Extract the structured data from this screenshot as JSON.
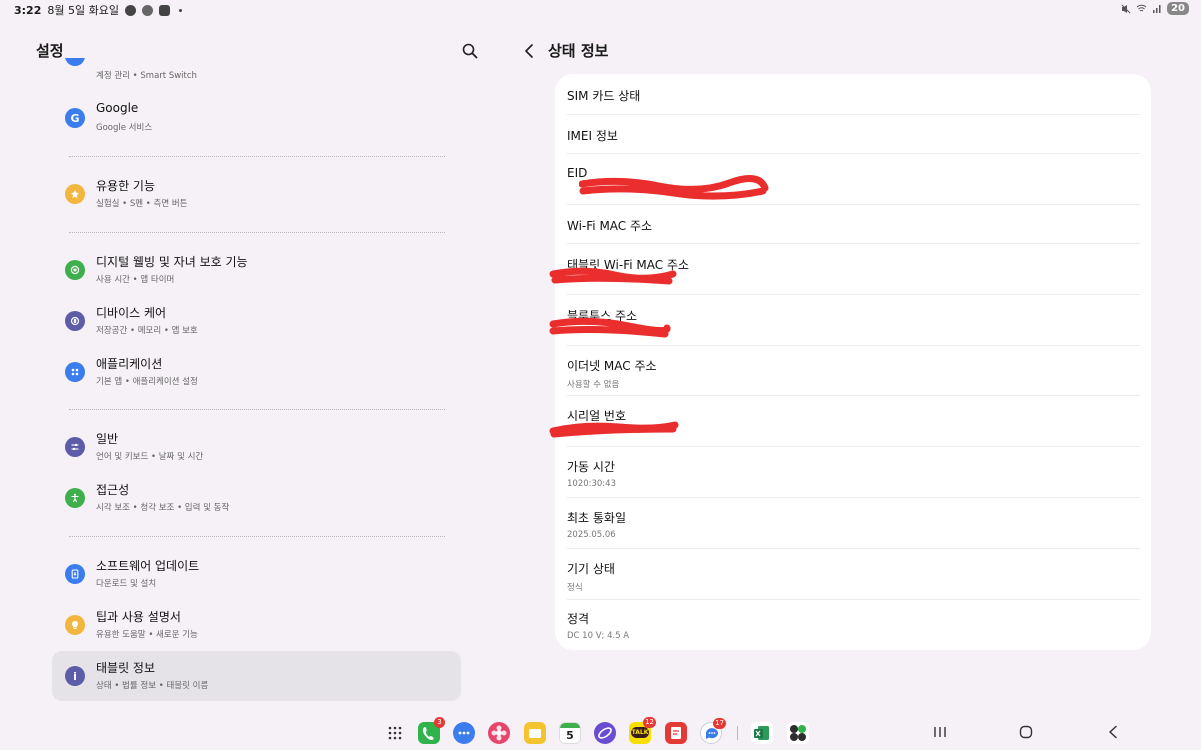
{
  "status_bar": {
    "time": "3:22",
    "date": "8월 5일 화요일",
    "battery": "20"
  },
  "left_panel": {
    "title": "설정",
    "partial_item_subtitle": "계정 관리 • Smart Switch",
    "items": [
      {
        "title": "Google",
        "subtitle": "Google 서비스",
        "icon": "google-icon",
        "color": "#3b7ded"
      },
      {
        "title": "유용한 기능",
        "subtitle": "실험실 • S펜 • 측면 버튼",
        "icon": "star-gear-icon",
        "color": "#f2b63f"
      },
      {
        "title": "디지털 웰빙 및 자녀 보호 기능",
        "subtitle": "사용 시간 • 앱 타이머",
        "icon": "wellbeing-heart-icon",
        "color": "#3fae4d"
      },
      {
        "title": "디바이스 케어",
        "subtitle": "저장공간 • 메모리 • 앱 보호",
        "icon": "device-care-icon",
        "color": "#5c5ca8"
      },
      {
        "title": "애플리케이션",
        "subtitle": "기본 앱 • 애플리케이션 설정",
        "icon": "apps-grid-icon",
        "color": "#3b7ded"
      },
      {
        "title": "일반",
        "subtitle": "언어 및 키보드 • 날짜 및 시간",
        "icon": "sliders-icon",
        "color": "#5c5ca8"
      },
      {
        "title": "접근성",
        "subtitle": "시각 보조 • 청각 보조 • 입력 및 동작",
        "icon": "accessibility-person-icon",
        "color": "#3fae4d"
      },
      {
        "title": "소프트웨어 업데이트",
        "subtitle": "다운로드 및 설치",
        "icon": "software-update-icon",
        "color": "#3b7ded"
      },
      {
        "title": "팁과 사용 설명서",
        "subtitle": "유용한 도움말 • 새로운 기능",
        "icon": "lightbulb-icon",
        "color": "#f2b63f"
      },
      {
        "title": "태블릿 정보",
        "subtitle": "상태 • 법률 정보 • 태블릿 이름",
        "icon": "info-icon",
        "color": "#5c5ca8"
      }
    ]
  },
  "right_panel": {
    "title": "상태 정보",
    "rows": [
      {
        "title": "SIM 카드 상태",
        "subtitle": ""
      },
      {
        "title": "IMEI 정보",
        "subtitle": ""
      },
      {
        "title": "EID",
        "subtitle": ""
      },
      {
        "title": "Wi-Fi MAC 주소",
        "subtitle": ""
      },
      {
        "title": "태블릿 Wi-Fi MAC 주소",
        "subtitle": ""
      },
      {
        "title": "블루투스 주소",
        "subtitle": ""
      },
      {
        "title": "이더넷 MAC 주소",
        "subtitle": "사용할 수 없음"
      },
      {
        "title": "시리얼 번호",
        "subtitle": ""
      },
      {
        "title": "가동 시간",
        "subtitle": "1020:30:43"
      },
      {
        "title": "최초 통화일",
        "subtitle": "2025.05.06"
      },
      {
        "title": "기기 상태",
        "subtitle": "정식"
      },
      {
        "title": "정격",
        "subtitle": "DC 10 V; 4.5 A"
      }
    ]
  },
  "dock": {
    "apps": [
      {
        "name": "phone-app-icon",
        "badge": "3",
        "color": "#2fb34a"
      },
      {
        "name": "messages-app-icon",
        "badge": "",
        "color": "#3b7ded"
      },
      {
        "name": "gallery-app-icon",
        "badge": "",
        "color": "#e8456b"
      },
      {
        "name": "my-files-app-icon",
        "badge": "",
        "color": "#f4c430"
      },
      {
        "name": "calendar-app-icon",
        "badge": "",
        "color": "#ffffff",
        "label": "5"
      },
      {
        "name": "internet-app-icon",
        "badge": "",
        "color": "#6a4cd1"
      },
      {
        "name": "kakaotalk-app-icon",
        "badge": "12",
        "color": "#f7e000",
        "label": "TALK"
      },
      {
        "name": "notes-app-icon",
        "badge": "",
        "color": "#e53935"
      },
      {
        "name": "chat-app-icon",
        "badge": "17",
        "color": "#3b7ded"
      },
      {
        "name": "excel-app-icon",
        "badge": "",
        "color": "#1d7a45"
      },
      {
        "name": "calculator-app-icon",
        "badge": "",
        "color": "#2d2d2d"
      }
    ]
  }
}
